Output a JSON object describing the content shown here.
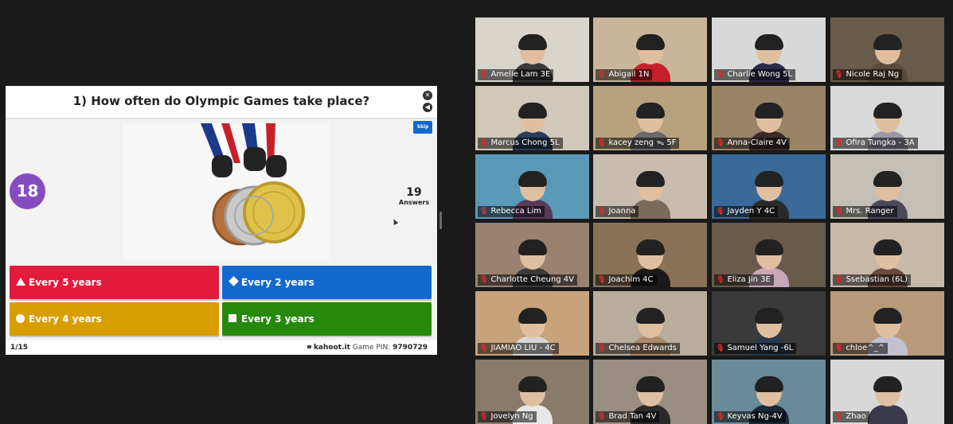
{
  "kahoot": {
    "question": "1) How often do Olympic Games take place?",
    "skip_label": "Skip",
    "timer": "18",
    "answers_count": "19",
    "answers_label": "Answers",
    "options": [
      {
        "label": "Every 5 years",
        "shape": "triangle-icon",
        "color": "#e21b3c"
      },
      {
        "label": "Every 2 years",
        "shape": "diamond-icon",
        "color": "#1368ce"
      },
      {
        "label": "Every 4 years",
        "shape": "circle-icon",
        "color": "#d89e00"
      },
      {
        "label": "Every 3 years",
        "shape": "square-icon",
        "color": "#26890c"
      }
    ],
    "progress": "1/15",
    "site": "kahoot.it",
    "pin_label": "Game PIN:",
    "pin": "9790729"
  },
  "gallery": {
    "participants": [
      {
        "name": "Amelie Lam 3E"
      },
      {
        "name": "Abigail 1N"
      },
      {
        "name": "Charlie Wong 5L"
      },
      {
        "name": "Nicole Raj Ng"
      },
      {
        "name": "Marcus Chong 5L"
      },
      {
        "name": "kacey zeng ᯓ 5F"
      },
      {
        "name": "Anna-Claire 4V"
      },
      {
        "name": "Ofira Tungka - 3A"
      },
      {
        "name": "Rebecca Lim"
      },
      {
        "name": "Joanna"
      },
      {
        "name": "Jayden Y 4C"
      },
      {
        "name": "Mrs. Ranger"
      },
      {
        "name": "Charlotte Cheung 4V"
      },
      {
        "name": "Joachim 4C"
      },
      {
        "name": "Eliza Jin 3E"
      },
      {
        "name": "Ssebastian (6L)"
      },
      {
        "name": "JIAMIAO LIU - 4C"
      },
      {
        "name": "Chelsea Edwards"
      },
      {
        "name": "Samuel Yang -6L"
      },
      {
        "name": "chloe^_^"
      },
      {
        "name": "Jovelyn Ng"
      },
      {
        "name": "Brad Tan 4V"
      },
      {
        "name": "Keyvas Ng-4V"
      },
      {
        "name": "Zhao"
      }
    ]
  }
}
